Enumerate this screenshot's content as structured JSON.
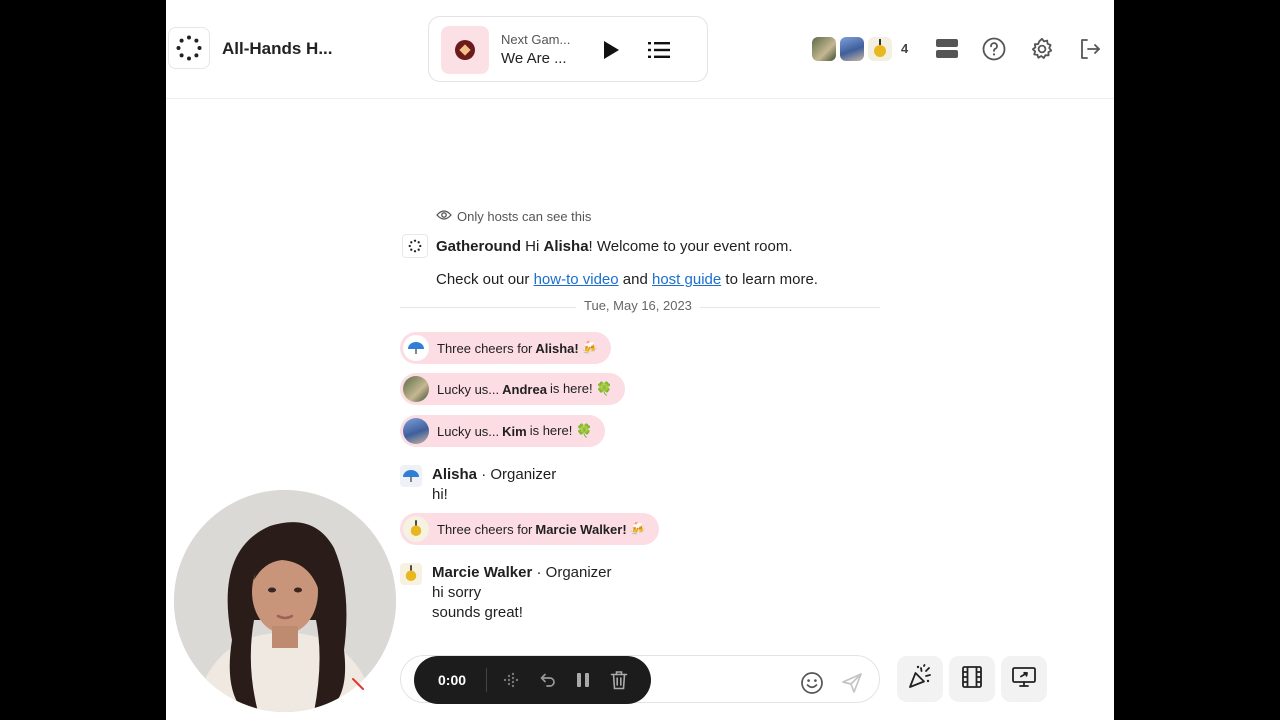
{
  "header": {
    "event_title": "All-Hands H...",
    "now_playing": {
      "line1": "Next Gam...",
      "line2": "We Are ..."
    },
    "participant_count": "4"
  },
  "chat": {
    "hosts_note": "Only hosts can see this",
    "welcome": {
      "sender": "Gatheround",
      "greeting": "Hi",
      "name": "Alisha",
      "rest": "! Welcome to your event room.",
      "line2_prefix": "Check out our",
      "link1": "how-to video",
      "and": "and",
      "link2": "host guide",
      "line2_suffix": "to learn more."
    },
    "date": "Tue, May 16, 2023",
    "events": [
      {
        "prefix": "Three cheers for",
        "name": "Alisha!",
        "suffix": "🍻"
      },
      {
        "prefix": "Lucky us...",
        "name": "Andrea",
        "suffix": "is here! 🍀"
      },
      {
        "prefix": "Lucky us...",
        "name": "Kim",
        "suffix": "is here! 🍀"
      },
      {
        "prefix": "Three cheers for",
        "name": "Marcie Walker!",
        "suffix": "🍻"
      }
    ],
    "messages": [
      {
        "name": "Alisha",
        "role": "· Organizer",
        "lines": [
          "hi!"
        ]
      },
      {
        "name": "Marcie Walker",
        "role": "· Organizer",
        "lines": [
          "hi sorry",
          "sounds great!"
        ]
      }
    ]
  },
  "recorder": {
    "time": "0:00"
  },
  "colors": {
    "accent_link": "#1a6fcf",
    "pill_bg": "#fbdde3",
    "recorder_bg": "#1c1c1c"
  },
  "icons": [
    "gatheround-logo-icon",
    "play-icon",
    "queue-list-icon",
    "layout-icon",
    "help-icon",
    "settings-icon",
    "exit-icon",
    "eye-icon",
    "waveform-icon",
    "undo-icon",
    "pause-icon",
    "trash-icon",
    "emoji-icon",
    "send-icon",
    "celebrate-icon",
    "film-icon",
    "screen-share-icon"
  ]
}
